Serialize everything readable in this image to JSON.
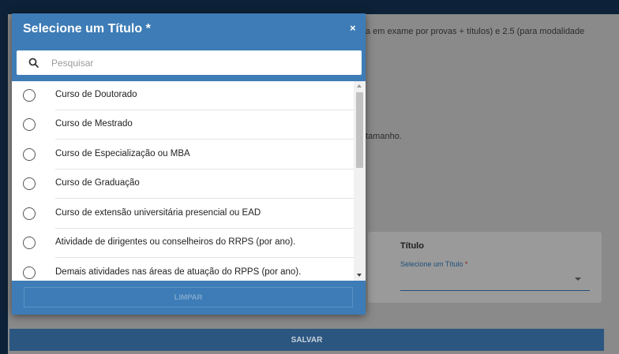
{
  "background": {
    "line1": "a em exame por provas + títulos) e 2.5 (para modalidade",
    "line2": "tamanho.",
    "card_title": "Título",
    "select_label": "Selecione um Título",
    "required_mark": "*",
    "save_label": "SALVAR"
  },
  "modal": {
    "title": "Selecione um Título *",
    "close_symbol": "×",
    "search": {
      "placeholder": "Pesquisar",
      "value": ""
    },
    "options": [
      "Curso de Doutorado",
      "Curso de Mestrado",
      "Curso de Especialização ou MBA",
      "Curso de Graduação",
      "Curso de extensão universitária presencial ou EAD",
      "Atividade de dirigentes ou conselheiros do RRPS (por ano).",
      "Demais atividades nas áreas de atuação do RPPS (por ano)."
    ],
    "clear_label": "LIMPAR"
  },
  "colors": {
    "header_blue": "#3d7cb6",
    "save_blue": "#2b5680",
    "overlay": "#8a8a8a"
  },
  "icons": [
    "search-icon",
    "close-icon",
    "radio-unchecked-icon",
    "chevron-down-icon"
  ]
}
